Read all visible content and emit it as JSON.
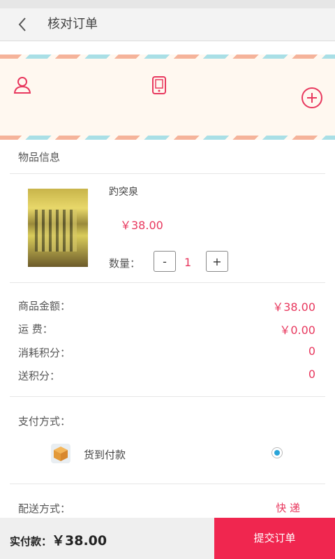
{
  "header": {
    "title": "核对订单"
  },
  "address": {
    "icons": [
      "person-icon",
      "phone-icon",
      "add-circle-icon"
    ]
  },
  "items_section": {
    "title": "物品信息"
  },
  "product": {
    "name": "趵突泉",
    "price": "￥38.00",
    "qty_label": "数量：",
    "minus": "-",
    "qty": "1",
    "plus": "+"
  },
  "summary": [
    {
      "label": "商品金额：",
      "value": "￥38.00"
    },
    {
      "label": "运  费：",
      "value": "￥0.00"
    },
    {
      "label": "消耗积分：",
      "value": "0"
    },
    {
      "label": "送积分：",
      "value": "0"
    }
  ],
  "payment": {
    "title": "支付方式：",
    "option": "货到付款",
    "selected": true
  },
  "delivery": {
    "title": "配送方式：",
    "value": "快 递"
  },
  "footer": {
    "total_label": "实付款：",
    "total_value": "￥38.00",
    "submit": "提交订单"
  },
  "colors": {
    "accent": "#f0264f",
    "price": "#e8385e",
    "radio": "#2aa4d8"
  }
}
